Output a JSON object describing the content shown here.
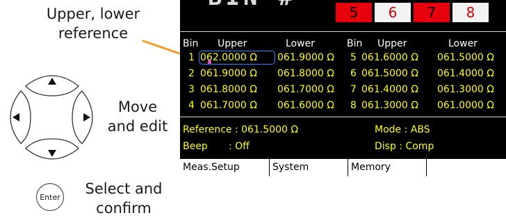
{
  "annotations": {
    "reference_line1": "Upper, lower",
    "reference_line2": "reference",
    "move_line1": "Move",
    "move_line2": "and edit",
    "select_line1": "Select and",
    "select_line2": "confirm"
  },
  "keys": {
    "enter_label": "Enter",
    "up": "arrow-up-icon",
    "down": "arrow-down-icon",
    "left": "arrow-left-icon",
    "right": "arrow-right-icon"
  },
  "screen": {
    "title_fragment": "BIN #",
    "pages": [
      {
        "label": "5",
        "state": "active"
      },
      {
        "label": "6",
        "state": "inactive"
      },
      {
        "label": "7",
        "state": "active"
      },
      {
        "label": "8",
        "state": "inactive"
      }
    ],
    "table": {
      "headers": [
        "Bin",
        "Upper",
        "Lower",
        "Bin",
        "Upper",
        "Lower"
      ],
      "rows": [
        {
          "bin_a": "1",
          "upper_a": "062.0000 Ω",
          "lower_a": "061.9000 Ω",
          "bin_b": "5",
          "upper_b": "061.6000 Ω",
          "lower_b": "061.5000 Ω"
        },
        {
          "bin_a": "2",
          "upper_a": "061.9000 Ω",
          "lower_a": "061.8000 Ω",
          "bin_b": "6",
          "upper_b": "061.5000 Ω",
          "lower_b": "061.4000 Ω"
        },
        {
          "bin_a": "3",
          "upper_a": "061.8000 Ω",
          "lower_a": "061.7000 Ω",
          "bin_b": "7",
          "upper_b": "061.4000 Ω",
          "lower_b": "061.3000 Ω"
        },
        {
          "bin_a": "4",
          "upper_a": "061.7000 Ω",
          "lower_a": "061.6000 Ω",
          "bin_b": "8",
          "upper_b": "061.3000 Ω",
          "lower_b": "061.0000 Ω"
        }
      ]
    },
    "info": {
      "reference": "Reference : 061.5000 Ω",
      "mode": "Mode : ABS",
      "beep_label": "Beep",
      "beep_value": ": Off",
      "disp": "Disp  : Comp"
    },
    "softkeys": [
      "Meas.Setup",
      "System",
      "Memory",
      ""
    ]
  },
  "colors": {
    "screen_bg": "#000000",
    "value_text": "#ffff00",
    "header_text": "#ffffff",
    "page_active": "#e8000c",
    "cursor": "#2f86ff",
    "leader_line": "#f59a1c"
  }
}
